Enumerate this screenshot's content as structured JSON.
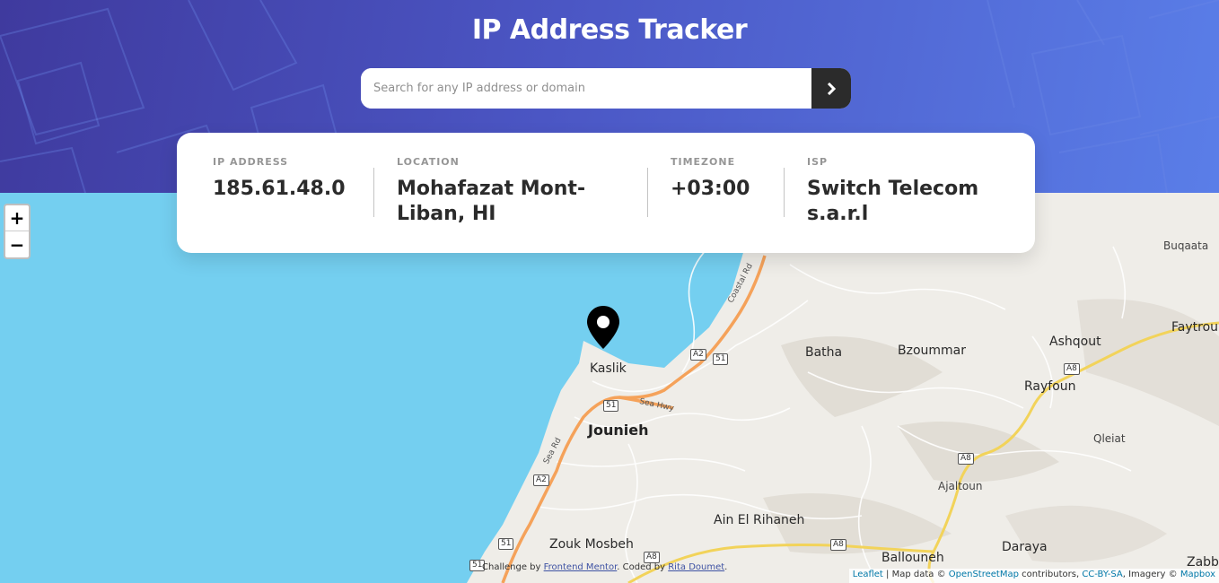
{
  "header": {
    "title": "IP Address Tracker",
    "search_placeholder": "Search for any IP address or domain",
    "search_value": "",
    "submit_icon": "chevron-right-icon"
  },
  "info": {
    "ip": {
      "label": "IP ADDRESS",
      "value": "185.61.48.0"
    },
    "location": {
      "label": "LOCATION",
      "value": "Mohafazat Mont-Liban, HI"
    },
    "timezone": {
      "label": "TIMEZONE",
      "value": "+03:00"
    },
    "isp": {
      "label": "ISP",
      "value": "Switch Telecom s.a.r.l"
    }
  },
  "map": {
    "zoom_in": "+",
    "zoom_out": "−",
    "places": {
      "kaslik": "Kaslik",
      "jounieh": "Jounieh",
      "batha": "Batha",
      "bzoummar": "Bzoummar",
      "ashqout": "Ashqout",
      "rayfoun": "Rayfoun",
      "buqaata": "Buqaata",
      "faytroun": "Faytrou",
      "qleiat": "Qleiat",
      "ajaltoun": "Ajaltoun",
      "ain_el_rihaneh": "Ain El Rihaneh",
      "zouk_mosbeh": "Zouk Mosbeh",
      "ballouneh": "Ballouneh",
      "daraya": "Daraya",
      "zabb": "Zabb"
    },
    "roads": {
      "coastal_rd": "Coastal Rd",
      "sea_hwy": "Sea Hwy",
      "sea_rd": "Sea Rd",
      "a2": "A2",
      "r51": "51",
      "a8": "A8"
    },
    "colors": {
      "water": "#74cff0",
      "land": "#efede8",
      "highway": "#f5a25a",
      "road_yellow": "#f2d35a"
    }
  },
  "attribution_left": {
    "prefix": "Challenge by ",
    "link1": "Frontend Mentor",
    "middle": ". Coded by ",
    "link2": "Rita Doumet",
    "suffix": "."
  },
  "attribution_right": {
    "leaflet": "Leaflet",
    "sep1": " | Map data © ",
    "osm": "OpenStreetMap",
    "sep2": " contributors, ",
    "ccbysa": "CC-BY-SA",
    "sep3": ", Imagery © ",
    "mapbox": "Mapbox"
  }
}
